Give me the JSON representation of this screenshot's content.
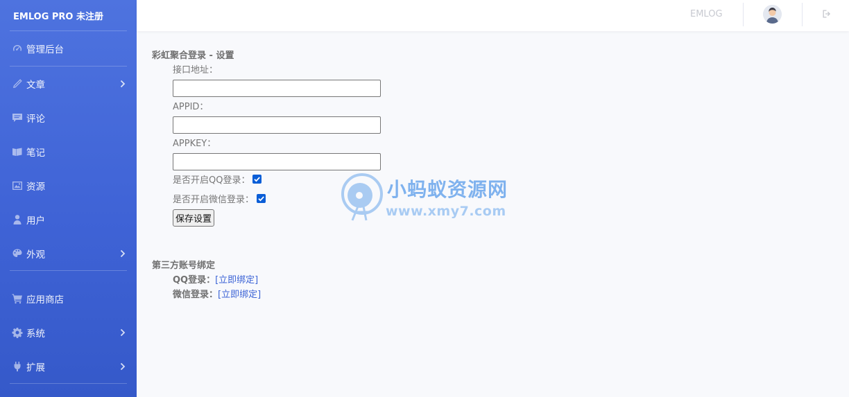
{
  "sidebar": {
    "brand": "EMLOG PRO 未注册",
    "items": [
      {
        "label": "管理后台",
        "icon": "dashboard-icon",
        "chevron": false
      },
      {
        "label": "文章",
        "icon": "pencil-icon",
        "chevron": true
      },
      {
        "label": "评论",
        "icon": "comment-icon",
        "chevron": false
      },
      {
        "label": "笔记",
        "icon": "note-icon",
        "chevron": false
      },
      {
        "label": "资源",
        "icon": "image-icon",
        "chevron": false
      },
      {
        "label": "用户",
        "icon": "user-icon",
        "chevron": false
      },
      {
        "label": "外观",
        "icon": "palette-icon",
        "chevron": true
      },
      {
        "label": "应用商店",
        "icon": "cart-icon",
        "chevron": false
      },
      {
        "label": "系统",
        "icon": "gear-icon",
        "chevron": true
      },
      {
        "label": "扩展",
        "icon": "plug-icon",
        "chevron": true
      }
    ]
  },
  "topbar": {
    "brand": "EMLOG",
    "avatar_icon": "user-avatar-icon",
    "logout_icon": "logout-icon"
  },
  "settings": {
    "title": "彩虹聚合登录 - 设置",
    "api_label": "接口地址：",
    "api_value": "",
    "appid_label": "APPID：",
    "appid_value": "",
    "appkey_label": "APPKEY：",
    "appkey_value": "",
    "qq_toggle_label": "是否开启QQ登录：",
    "qq_toggle_checked": true,
    "wechat_toggle_label": "是否开启微信登录：",
    "wechat_toggle_checked": true,
    "save_label": "保存设置"
  },
  "binding": {
    "title": "第三方账号绑定",
    "qq_label": "QQ登录：",
    "qq_link": "[立即绑定]",
    "wechat_label": "微信登录：",
    "wechat_link": "[立即绑定]"
  },
  "watermark": {
    "text": "小蚂蚁资源网",
    "url": "www.xmy7.com"
  },
  "colors": {
    "sidebar_top": "#4e73df",
    "sidebar_bottom": "#3559c9",
    "checkbox": "#0b5ed7",
    "link": "#3b63d6"
  }
}
